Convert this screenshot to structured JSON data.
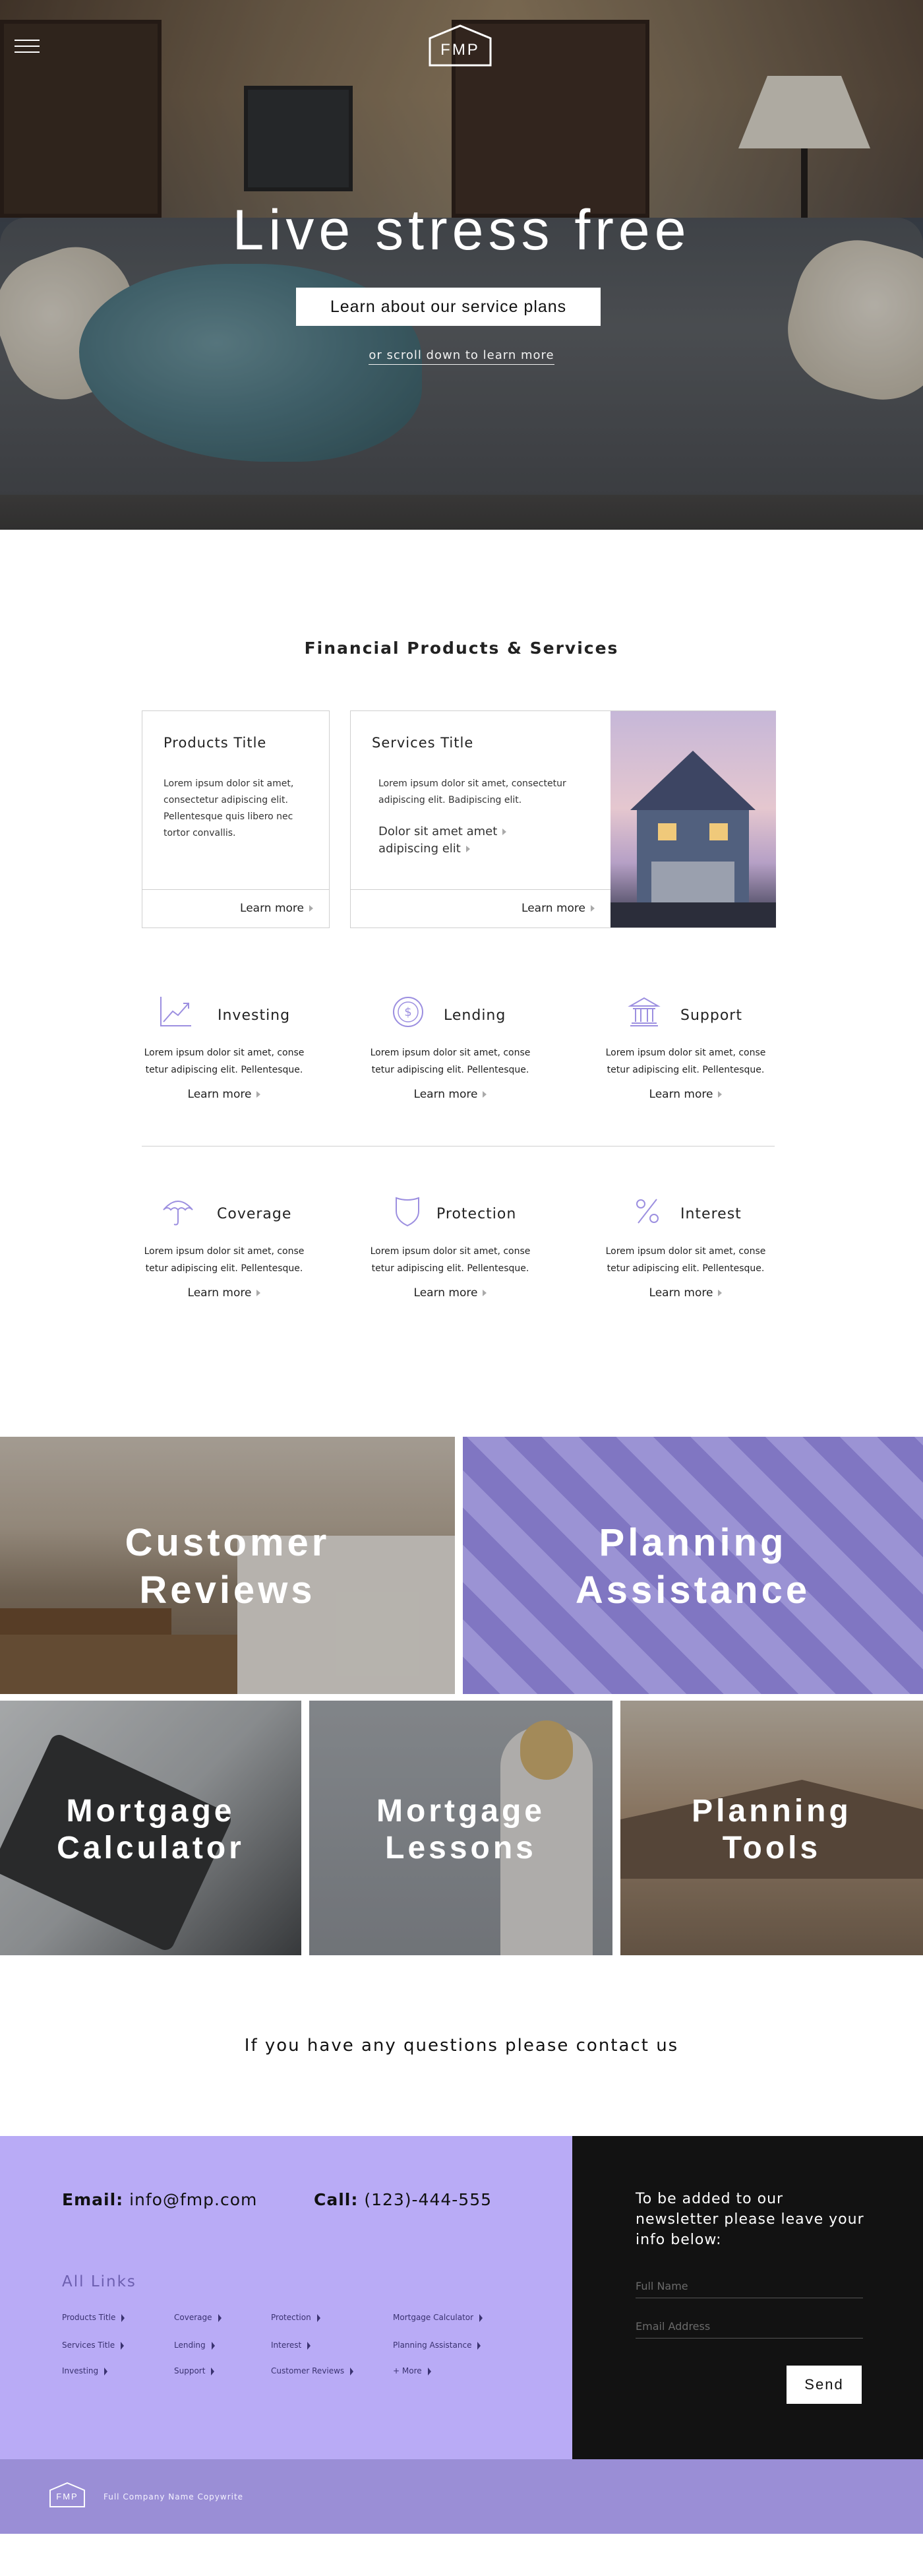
{
  "brand": {
    "logo_text": "FMP"
  },
  "hero": {
    "title": "Live stress free",
    "cta_label": "Learn about our service plans",
    "scroll_text": "or scroll down to learn more"
  },
  "section_title": "Financial Products & Services",
  "cards": {
    "products": {
      "title": "Products Title",
      "body": "Lorem ipsum dolor sit amet, consectetur adipiscing elit. Pellentesque quis libero nec tortor convallis.",
      "learn_more": "Learn more"
    },
    "services": {
      "title": "Services Title",
      "body": "Lorem ipsum dolor sit amet, consectetur adipiscing elit. Badipiscing elit.",
      "sublinks": [
        "Dolor sit amet amet",
        "adipiscing elit"
      ],
      "learn_more": "Learn more"
    }
  },
  "features_row1": [
    {
      "icon": "chart-trend-icon",
      "label": "Investing",
      "body": "Lorem ipsum dolor sit amet, conse tetur adipiscing elit. Pellentesque.",
      "more": "Learn more"
    },
    {
      "icon": "dollar-coin-icon",
      "label": "Lending",
      "body": "Lorem ipsum dolor sit amet, conse tetur adipiscing elit. Pellentesque.",
      "more": "Learn more"
    },
    {
      "icon": "bank-icon",
      "label": "Support",
      "body": "Lorem ipsum dolor sit amet, conse tetur adipiscing elit. Pellentesque.",
      "more": "Learn more"
    }
  ],
  "features_row2": [
    {
      "icon": "umbrella-icon",
      "label": "Coverage",
      "body": "Lorem ipsum dolor sit amet, conse tetur adipiscing elit. Pellentesque.",
      "more": "Learn more"
    },
    {
      "icon": "shield-icon",
      "label": "Protection",
      "body": "Lorem ipsum dolor sit amet, conse tetur adipiscing elit. Pellentesque.",
      "more": "Learn more"
    },
    {
      "icon": "percent-icon",
      "label": "Interest",
      "body": "Lorem ipsum dolor sit amet, conse tetur adipiscing elit. Pellentesque.",
      "more": "Learn more"
    }
  ],
  "tiles": {
    "customer_reviews": {
      "line1": "Customer",
      "line2": "Reviews"
    },
    "planning_assistance": {
      "line1": "Planning",
      "line2": "Assistance"
    },
    "mortgage_calculator": {
      "line1": "Mortgage",
      "line2": "Calculator"
    },
    "mortgage_lessons": {
      "line1": "Mortgage",
      "line2": "Lessons"
    },
    "planning_tools": {
      "line1": "Planning",
      "line2": "Tools"
    }
  },
  "contact_prompt": "If you have any questions please contact us",
  "contact": {
    "email_label": "Email:",
    "email_value": "info@fmp.com",
    "call_label": "Call:",
    "call_value": "(123)-444-555"
  },
  "all_links": {
    "heading": "All Links",
    "col1": [
      "Products Title",
      "Services Title",
      "Investing"
    ],
    "col2": [
      "Coverage",
      "Lending",
      "Support"
    ],
    "col3": [
      "Protection",
      "Interest",
      "Customer Reviews"
    ],
    "col4": [
      "Mortgage Calculator",
      "Planning Assistance",
      "+ More"
    ]
  },
  "newsletter": {
    "text": "To be added to our newsletter please leave your info below:",
    "name_placeholder": "Full Name",
    "email_placeholder": "Email Address",
    "send_label": "Send"
  },
  "bottom_bar": {
    "logo_text": "FMP",
    "copyright": "Full Company Name Copywrite"
  },
  "colors": {
    "accent": "#b9abf6",
    "bottom_bar": "#9a8ed6",
    "dark": "#121212",
    "icon": "#9c8fe0"
  }
}
